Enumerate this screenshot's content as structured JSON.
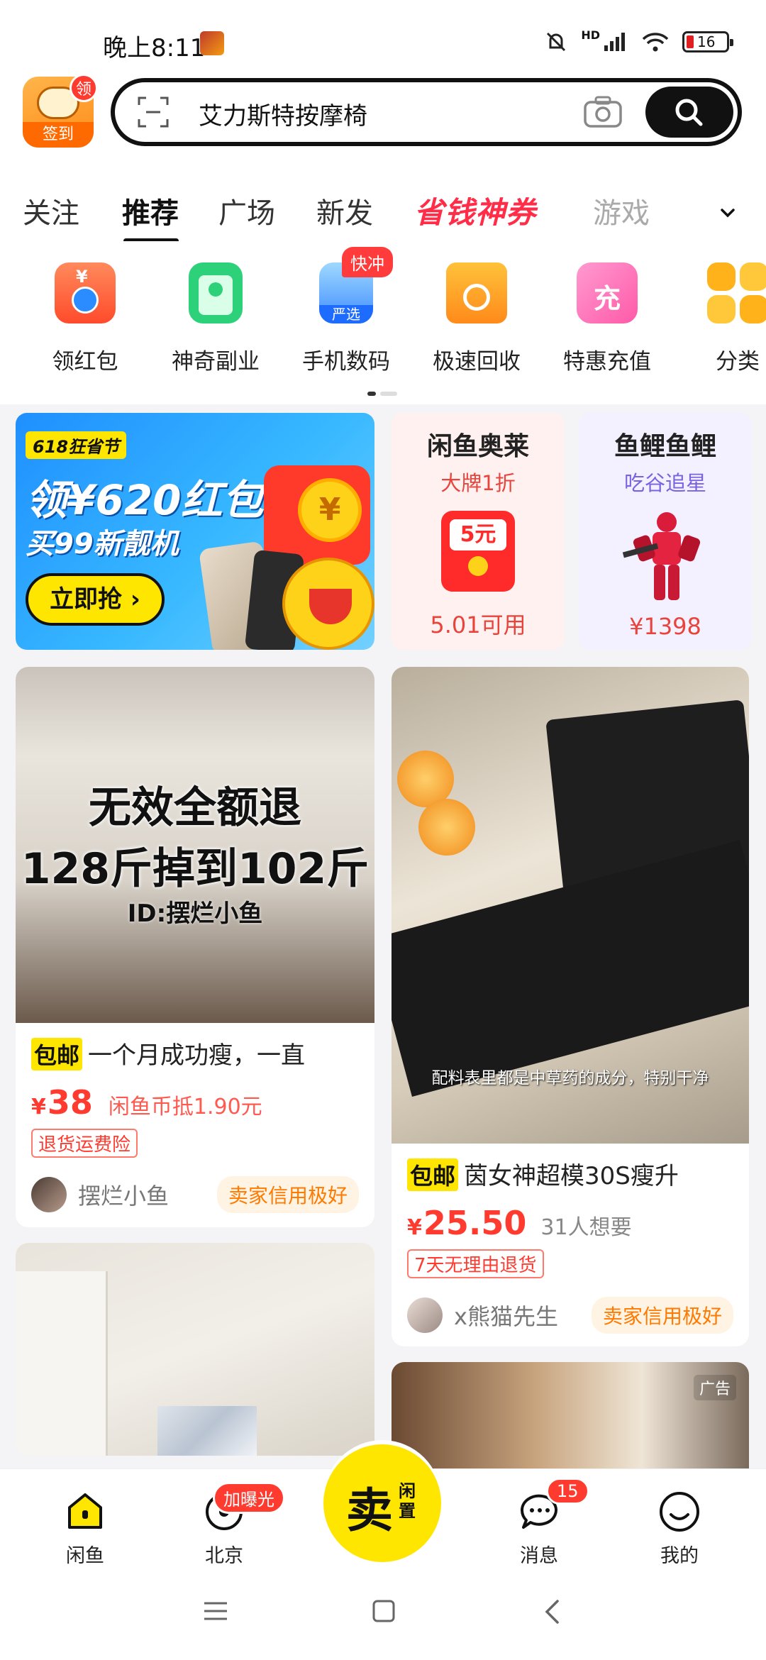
{
  "status_bar": {
    "time": "晚上8:11",
    "network": "HD",
    "battery": "16"
  },
  "header": {
    "signin": {
      "badge": "领",
      "label": "签到"
    },
    "search": {
      "query": "艾力斯特按摩椅"
    }
  },
  "tabs": {
    "items": [
      "关注",
      "推荐",
      "广场",
      "新发"
    ],
    "promo": "省钱神券",
    "game": "游戏",
    "active": "推荐"
  },
  "categories": [
    {
      "label": "领红包",
      "icon": "red-envelope-icon"
    },
    {
      "label": "神奇副业",
      "icon": "id-badge-icon"
    },
    {
      "label": "手机数码",
      "icon": "phone-icon",
      "badge": "快冲",
      "sub": "严选"
    },
    {
      "label": "极速回收",
      "icon": "recycle-box-icon"
    },
    {
      "label": "特惠充值",
      "icon": "recharge-icon",
      "glyph": "充"
    },
    {
      "label": "分类",
      "icon": "grid-icon"
    }
  ],
  "promo_banner": {
    "tag": "618狂省节",
    "title": "领¥620红包",
    "subtitle": "买99新靓机",
    "button": "立即抢",
    "coin": "¥"
  },
  "mini_cards": {
    "outlet": {
      "title": "闲鱼奥莱",
      "subtitle": "大牌1折",
      "envelope": "5元",
      "price": "5.01可用"
    },
    "carp": {
      "title": "鱼鲤鱼鲤",
      "subtitle": "吃谷追星",
      "price": "¥1398"
    }
  },
  "feed": [
    {
      "overlay": [
        "无效全额退",
        "128斤掉到102斤",
        "ID:摆烂小鱼"
      ],
      "ship_tag": "包邮",
      "title": "一个月成功瘦，一直",
      "currency": "¥",
      "price": "38",
      "extra": "闲鱼币抵1.90元",
      "service_tag": "退货运费险",
      "seller": "摆烂小鱼",
      "credit": "卖家信用极好"
    },
    {
      "caption": "配料表里都是中草药的成分，特别干净",
      "ship_tag": "包邮",
      "title": "茵女神超模30S瘦升",
      "currency": "¥",
      "price": "25.50",
      "want": "31人想要",
      "service_tag": "7天无理由退货",
      "seller": "x熊猫先生",
      "credit": "卖家信用极好"
    },
    {
      "ad": "广告"
    }
  ],
  "bottom_nav": {
    "home": "闲鱼",
    "city": "北京",
    "city_badge": "加曝光",
    "sell_big": "卖",
    "sell_small": "闲置",
    "messages": "消息",
    "messages_badge": "15",
    "me": "我的"
  },
  "colors": {
    "brand_yellow": "#ffe600",
    "price_red": "#ff3b30",
    "promo_red": "#ff2d48"
  }
}
